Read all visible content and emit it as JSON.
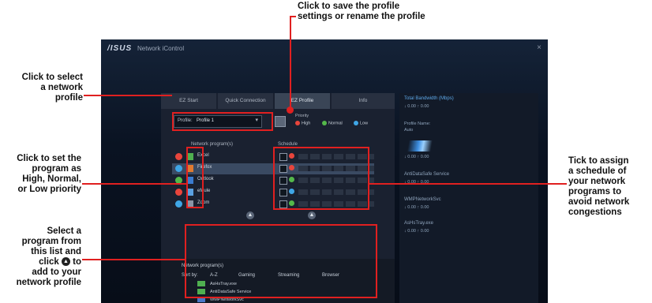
{
  "annotations": {
    "save_profile": "Click to save the profile\nsettings or rename the profile",
    "select_profile": "Click to select\na network\nprofile",
    "set_priority": "Click to set the\nprogram as\nHigh, Normal,\nor Low priority",
    "select_program_pre": "Select a\nprogram from\nthis list and\nclick",
    "select_program_post": "to\nadd to your\nnetwork profile",
    "tick_schedule": "Tick to assign\na schedule of\nyour network\nprograms to\navoid network\ncongestions"
  },
  "app": {
    "logo": "/ISUS",
    "title": "Network iControl",
    "close": "×",
    "tabs": [
      "EZ Start",
      "Quick Connection",
      "EZ Profile",
      "Info"
    ],
    "active_tab": "EZ Profile",
    "profile_label": "Profile:",
    "profile_value": "Profile 1",
    "priority_label": "Priority",
    "priority_options": [
      "High",
      "Normal",
      "Low"
    ],
    "network_programs_header": "Network program(s)",
    "schedule_header": "Schedule",
    "programs": [
      "Excel",
      "Firefox",
      "Outlook",
      "eMule",
      "Zoom"
    ],
    "network_program_list_header": "Network program(s)",
    "sort_label": "Sort by:",
    "sort_options": [
      "A-Z",
      "Gaming",
      "Streaming",
      "Browser"
    ],
    "list_items": [
      "AsHsTray.exe",
      "AntiDataSafe Service",
      "WMPNetworkSvc"
    ],
    "side": {
      "total_bandwidth": "Total Bandwidth (Mbps)",
      "bandwidth_val": "↓ 0.00   ↑ 0.00",
      "profile_name_label": "Profile Name:",
      "profile_name_val": "Auto",
      "items": [
        "AntiDataSafe Service",
        "WMPNetworkSvc",
        "AsHsTray.exe"
      ],
      "item_vals": "↓ 0.00   ↑ 0.00"
    }
  },
  "colors": {
    "annotation_red": "#e02020",
    "high": "#e8453c",
    "normal": "#54b84a",
    "low": "#3fa6e6"
  }
}
